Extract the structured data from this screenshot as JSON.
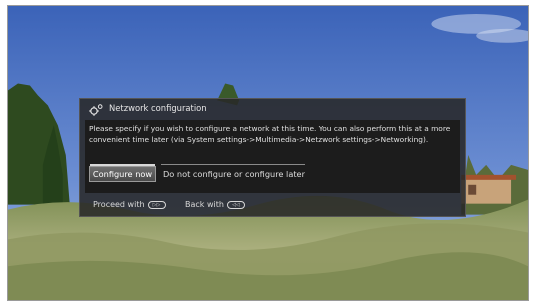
{
  "dialog": {
    "title": "Netzwork configuration",
    "icon": "gear-icon",
    "message": "Please specify if you wish to configure a network at this time. You can also perform this at a more convenient time later (via System settings->Multimedia->Netzwork settings->Networking).",
    "options": [
      {
        "label": "Configure now",
        "selected": true
      },
      {
        "label": "Do not configure or configure later",
        "selected": false
      }
    ],
    "footer": {
      "proceed_label": "Proceed with",
      "proceed_key": "▷▷",
      "back_label": "Back with",
      "back_key": "◁◁"
    }
  },
  "colors": {
    "dialog_bg": "#282828",
    "body_bg": "#1c1c1c",
    "text": "#e0e0e0",
    "selected_button": "#5a5a5a"
  }
}
